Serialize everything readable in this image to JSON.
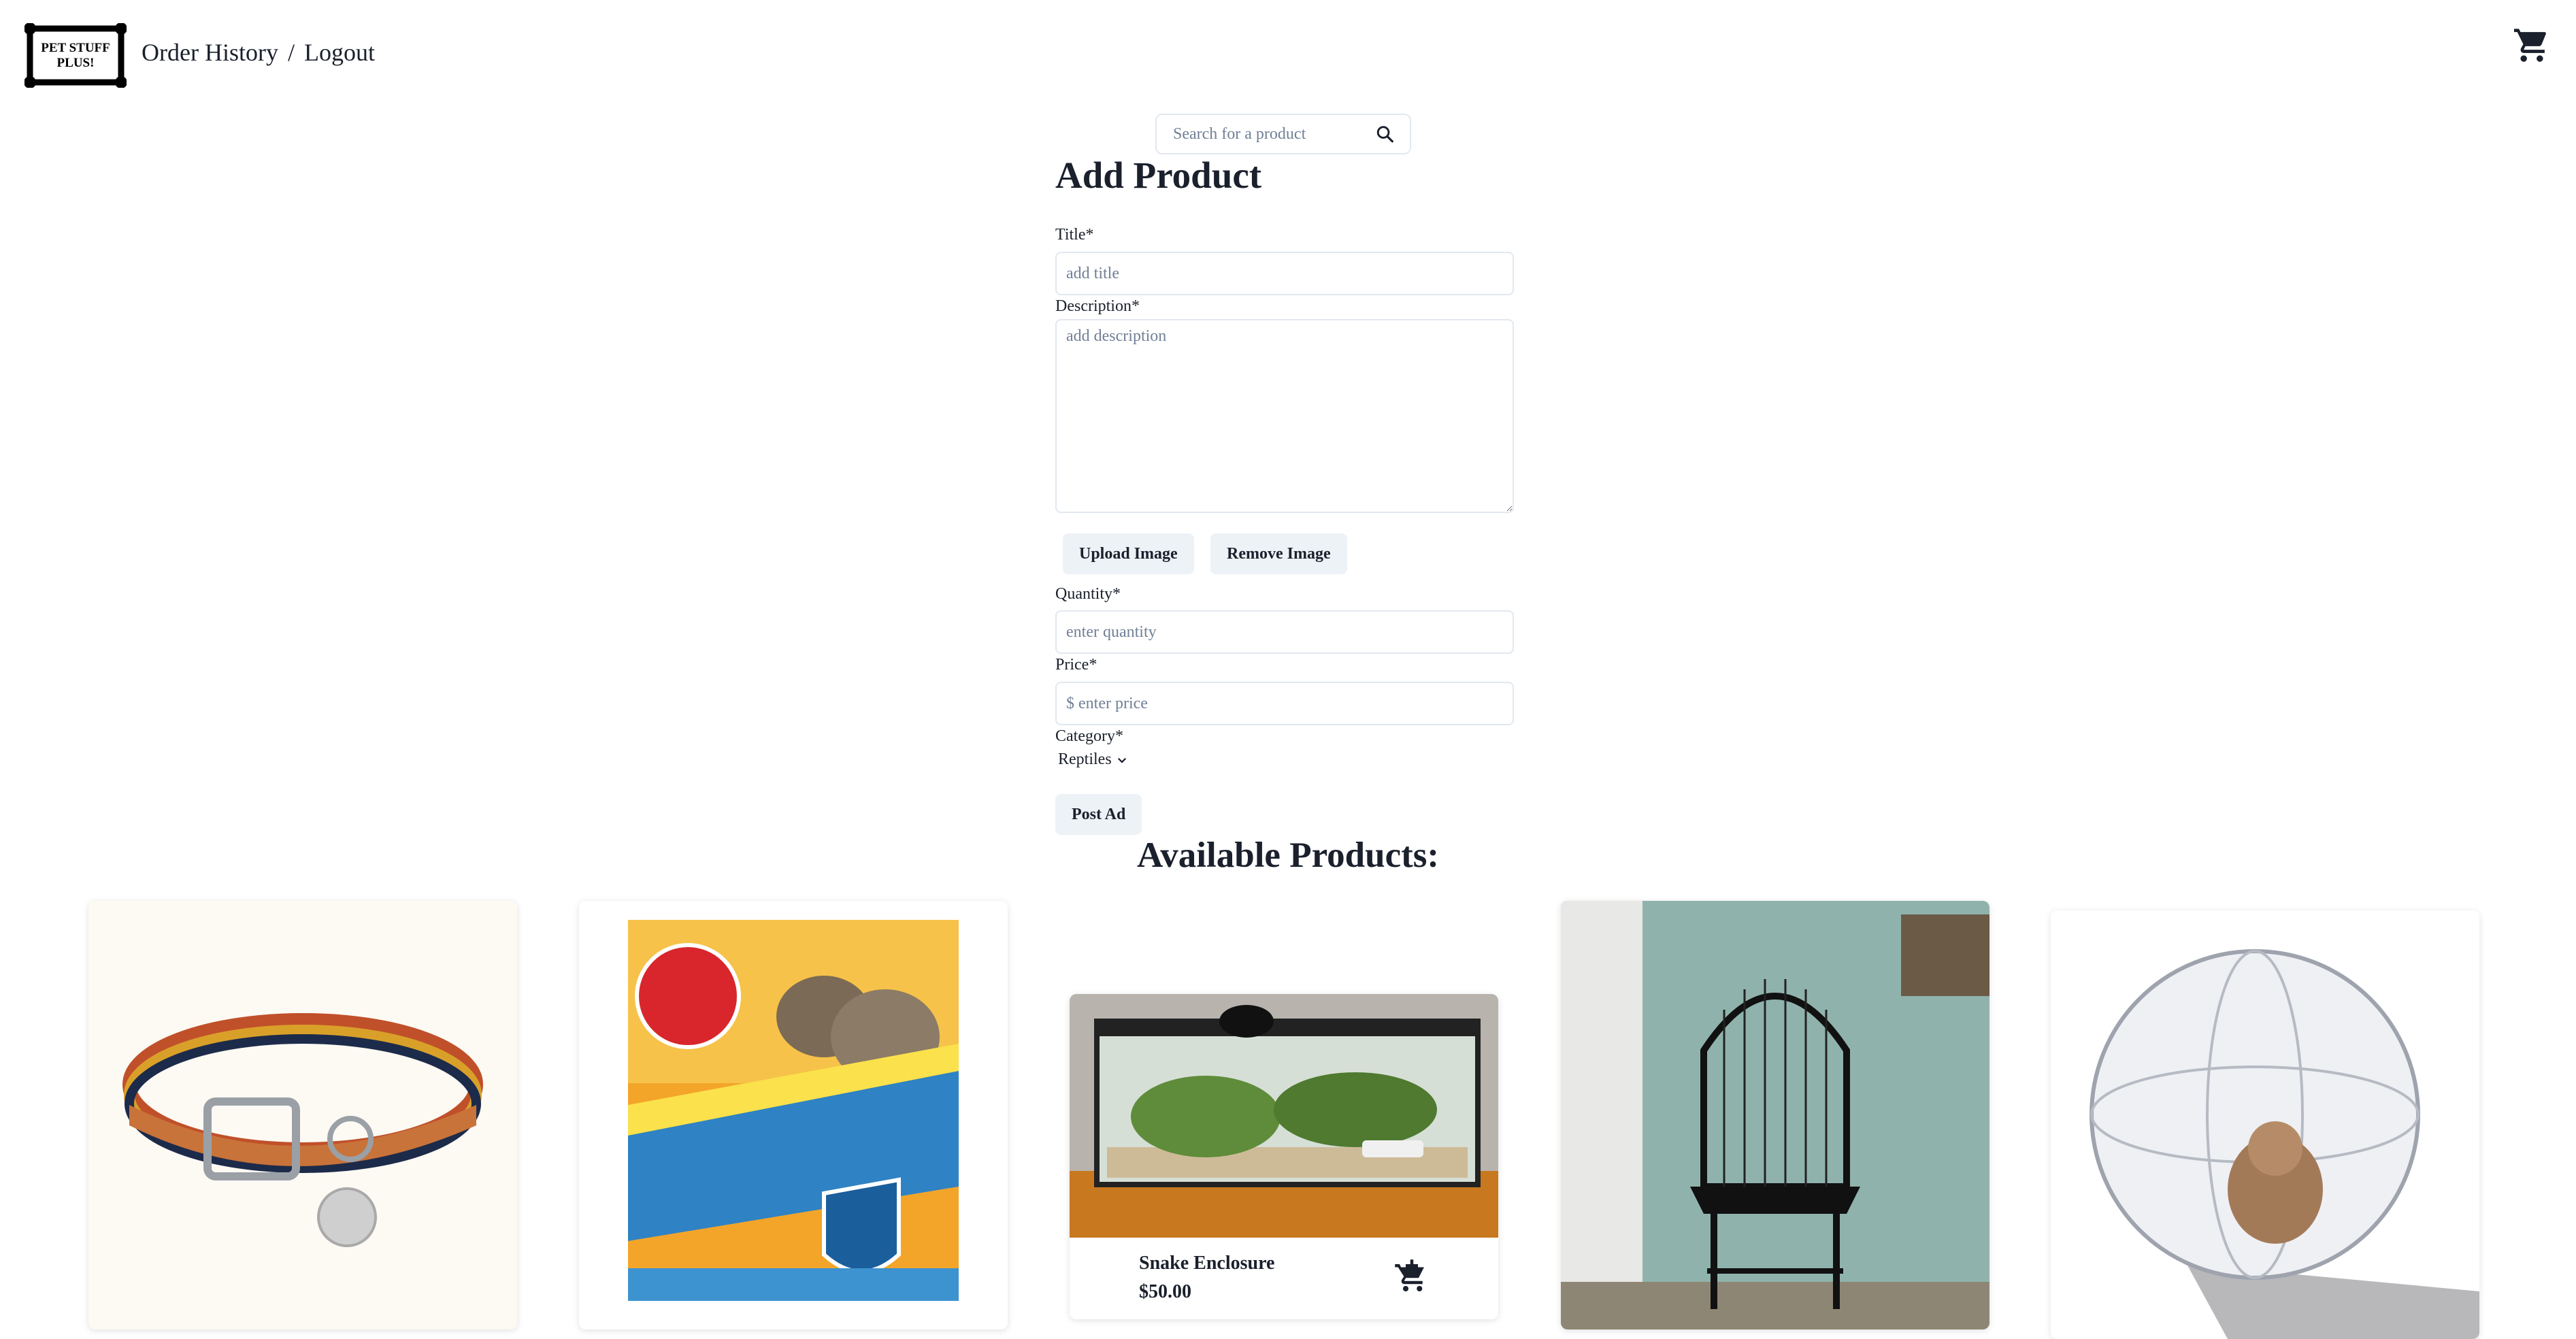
{
  "header": {
    "logo_text_line1": "PET STUFF",
    "logo_text_line2": "PLUS!",
    "nav_order_history": "Order History",
    "nav_separator": "/",
    "nav_logout": "Logout",
    "cart_icon": "shopping-cart-icon"
  },
  "search": {
    "placeholder": "Search for a product",
    "icon": "search-icon"
  },
  "form": {
    "title": "Add Product",
    "title_label": "Title*",
    "title_placeholder": "add title",
    "description_label": "Description*",
    "description_placeholder": "add description",
    "upload_image": "Upload Image",
    "remove_image": "Remove Image",
    "quantity_label": "Quantity*",
    "quantity_placeholder": "enter quantity",
    "price_label": "Price*",
    "price_placeholder": "$ enter price",
    "category_label": "Category*",
    "category_value": "Reptiles",
    "post_ad": "Post Ad"
  },
  "products_section": {
    "title": "Available Products:",
    "products": [
      {
        "image": "dog-collar-image",
        "name": "",
        "price": ""
      },
      {
        "image": "cat-litter-box-image",
        "name": "",
        "price": ""
      },
      {
        "image": "snake-enclosure-image",
        "name": "Snake Enclosure",
        "price": "$50.00",
        "cart_icon": "add-to-cart-icon"
      },
      {
        "image": "bird-cage-image",
        "name": "",
        "price": ""
      },
      {
        "image": "hamster-ball-image",
        "name": "",
        "price": ""
      }
    ]
  },
  "colors": {
    "text": "#1a202c",
    "button_bg": "#edf2f7",
    "border": "#e2e8f0",
    "placeholder": "#718096"
  }
}
